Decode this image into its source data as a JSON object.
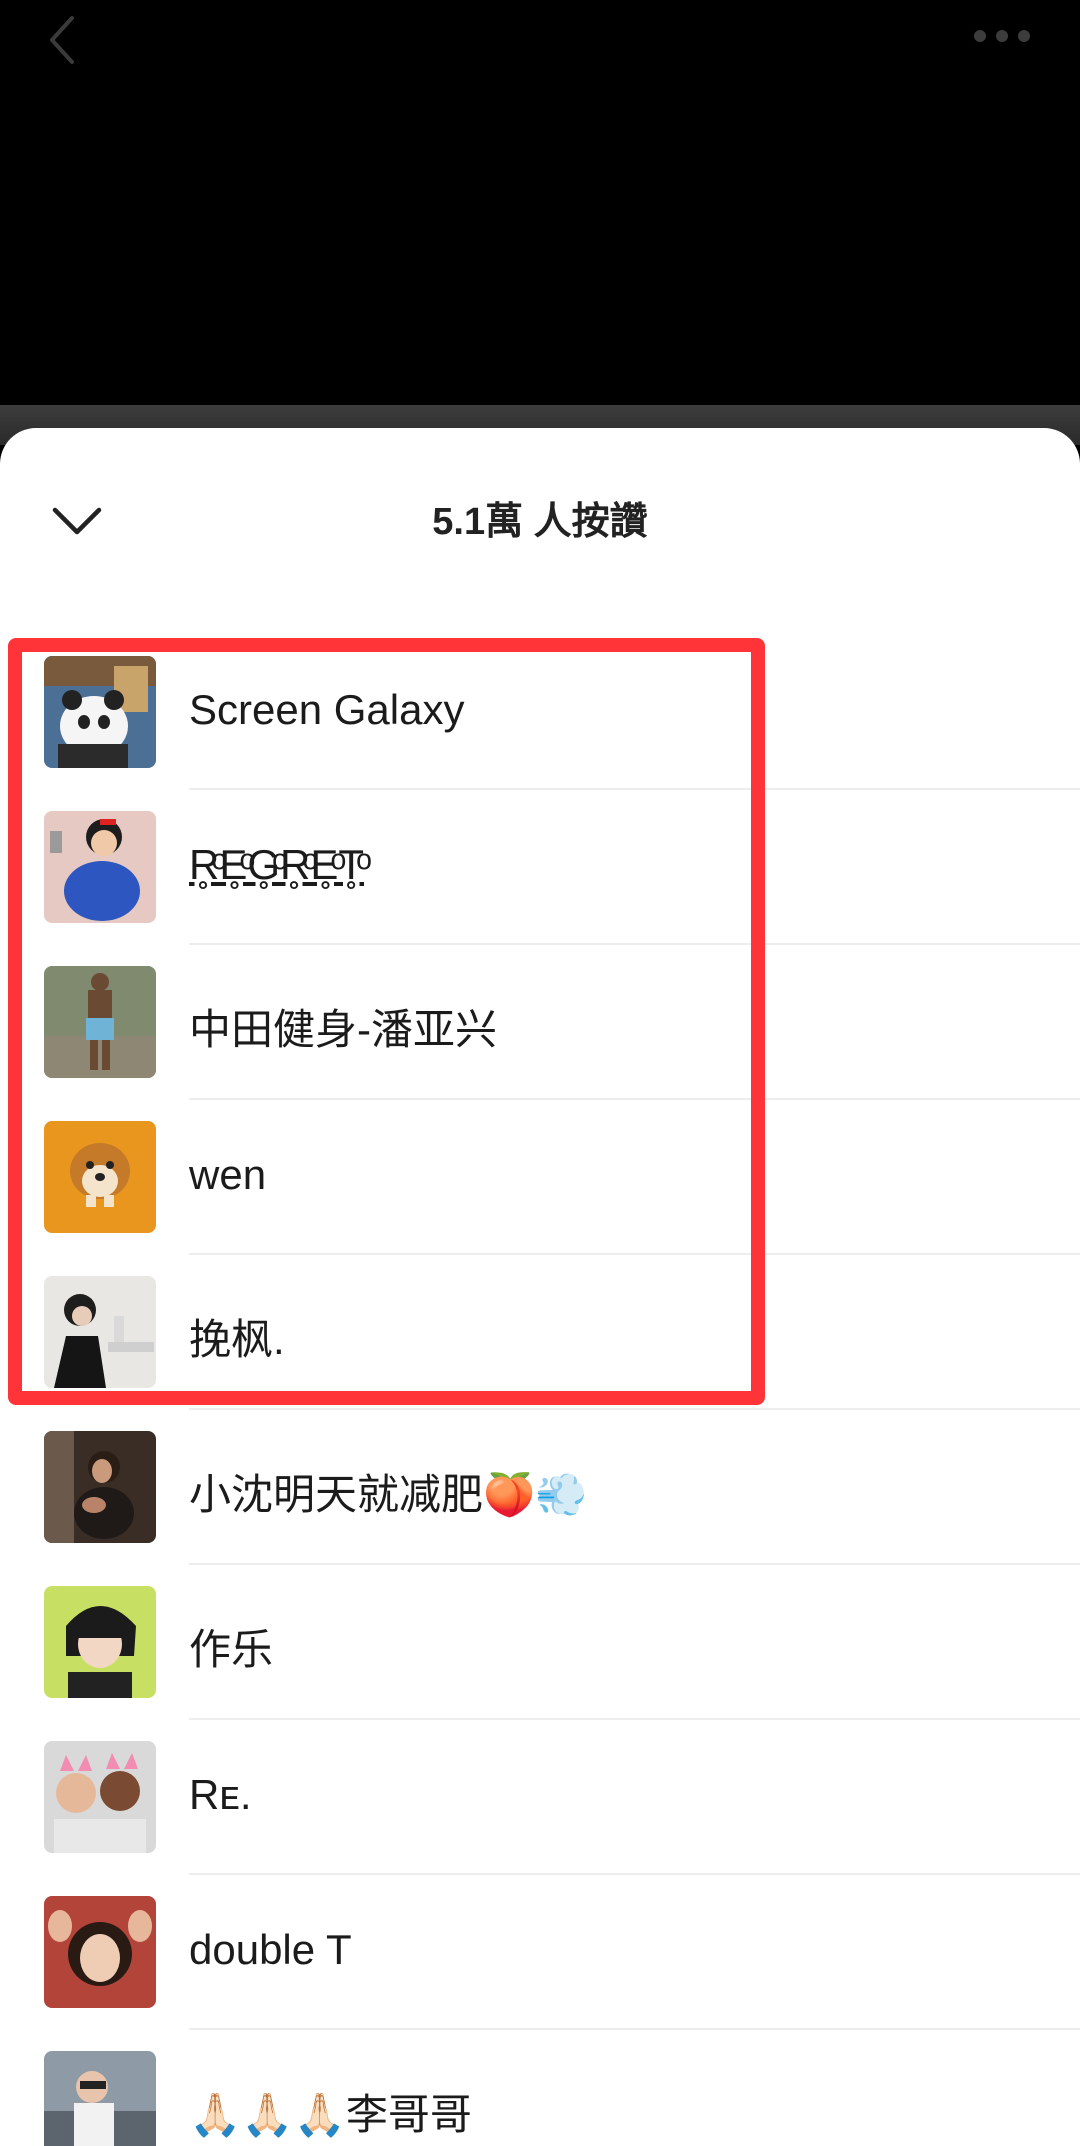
{
  "header": {
    "more_label": "•••"
  },
  "sheet": {
    "title": "5.1萬 人按讚"
  },
  "likers": [
    {
      "name": "Screen Galaxy"
    },
    {
      "name": "R̥ͦE̥ͦG̥ͦR̥ͦE̥ͦT̥ͦ"
    },
    {
      "name": "中田健身-潘亚兴"
    },
    {
      "name": "wen"
    },
    {
      "name": "挽枫."
    },
    {
      "name": "小沈明天就减肥🍑💨"
    },
    {
      "name": "作乐"
    },
    {
      "name": "Rᴇ."
    },
    {
      "name": "double T"
    },
    {
      "name": "🙏🏻🙏🏻🙏🏻李哥哥"
    }
  ],
  "colors": {
    "highlight": "#ff3439",
    "sheet_bg": "#ffffff",
    "top_bg": "#000000"
  }
}
